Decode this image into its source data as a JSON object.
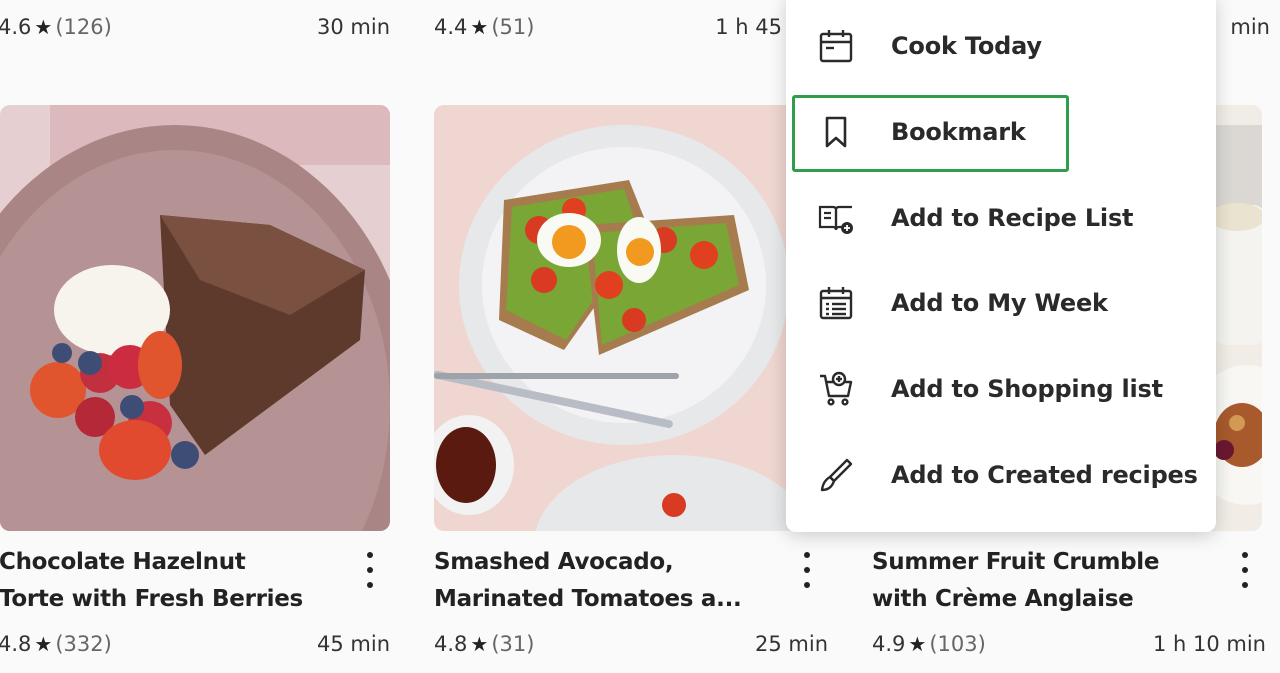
{
  "top_row": [
    {
      "rating": "4.6",
      "count": "(126)",
      "time": "30 min"
    },
    {
      "rating": "4.4",
      "count": "(51)",
      "time": "1 h 45"
    },
    {
      "time": "min"
    }
  ],
  "cards": [
    {
      "title_line1": "Chocolate Hazelnut",
      "title_line2": "Torte with Fresh Berries",
      "rating": "4.8",
      "count": "(332)",
      "time": "45 min"
    },
    {
      "title_line1": "Smashed Avocado,",
      "title_line2": "Marinated Tomatoes a...",
      "rating": "4.8",
      "count": "(31)",
      "time": "25 min"
    },
    {
      "title_line1": "Summer Fruit Crumble",
      "title_line2": "with Crème Anglaise",
      "rating": "4.9",
      "count": "(103)",
      "time": "1 h 10 min"
    }
  ],
  "menu": {
    "items": [
      {
        "label": "Cook Today",
        "icon": "calendar-icon"
      },
      {
        "label": "Bookmark",
        "icon": "bookmark-icon"
      },
      {
        "label": "Add to Recipe List",
        "icon": "recipe-book-add-icon"
      },
      {
        "label": "Add to My Week",
        "icon": "calendar-week-icon"
      },
      {
        "label": "Add to Shopping list",
        "icon": "cart-add-icon"
      },
      {
        "label": "Add to Created recipes",
        "icon": "brush-icon"
      }
    ],
    "highlighted": "Bookmark"
  },
  "colors": {
    "highlight": "#2e9e4a",
    "text": "#222222",
    "background": "#fafafa"
  },
  "icons": {
    "star": "star-icon",
    "more": "kebab-menu-icon"
  }
}
